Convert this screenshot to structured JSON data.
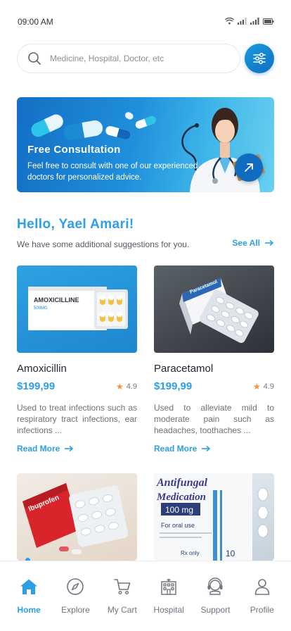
{
  "status_bar": {
    "time": "09:00 AM"
  },
  "search": {
    "placeholder": "Medicine, Hospital, Doctor, etc"
  },
  "banner": {
    "title": "Free Consultation",
    "text": "Feel free to consult with one of our experienced doctors for personalized advice."
  },
  "greeting": {
    "title": "Hello, Yael Amari!",
    "subtitle": "We have some additional suggestions for you.",
    "see_all": "See All"
  },
  "products": [
    {
      "name": "Amoxicillin",
      "price": "$199,99",
      "rating": "4.9",
      "description": "Used to treat infections such as respiratory tract infections, ear infections ...",
      "read_more": "Read More",
      "box_label": "AMOXICILLINE",
      "box_sub": "500MG"
    },
    {
      "name": "Paracetamol",
      "price": "$199,99",
      "rating": "4.9",
      "description": "Used to alleviate mild to moderate pain such as headaches, toothaches ...",
      "read_more": "Read More",
      "box_label": "Paracetamol"
    },
    {
      "box_label": "Ibuprofen"
    },
    {
      "box_title_1": "Antifungal",
      "box_title_2": "Medication",
      "box_dose": "100 mg",
      "box_use": "For oral use",
      "box_rx": "Rx only",
      "box_count": "10"
    }
  ],
  "nav": [
    {
      "label": "Home",
      "icon": "home-icon",
      "active": true
    },
    {
      "label": "Explore",
      "icon": "compass-icon",
      "active": false
    },
    {
      "label": "My Cart",
      "icon": "cart-icon",
      "active": false
    },
    {
      "label": "Hospital",
      "icon": "hospital-icon",
      "active": false
    },
    {
      "label": "Support",
      "icon": "headset-icon",
      "active": false
    },
    {
      "label": "Profile",
      "icon": "user-icon",
      "active": false
    }
  ],
  "colors": {
    "accent": "#2d9fe6",
    "star": "#f1913a",
    "banner_start": "#136fc5",
    "banner_end": "#69d0f0"
  }
}
